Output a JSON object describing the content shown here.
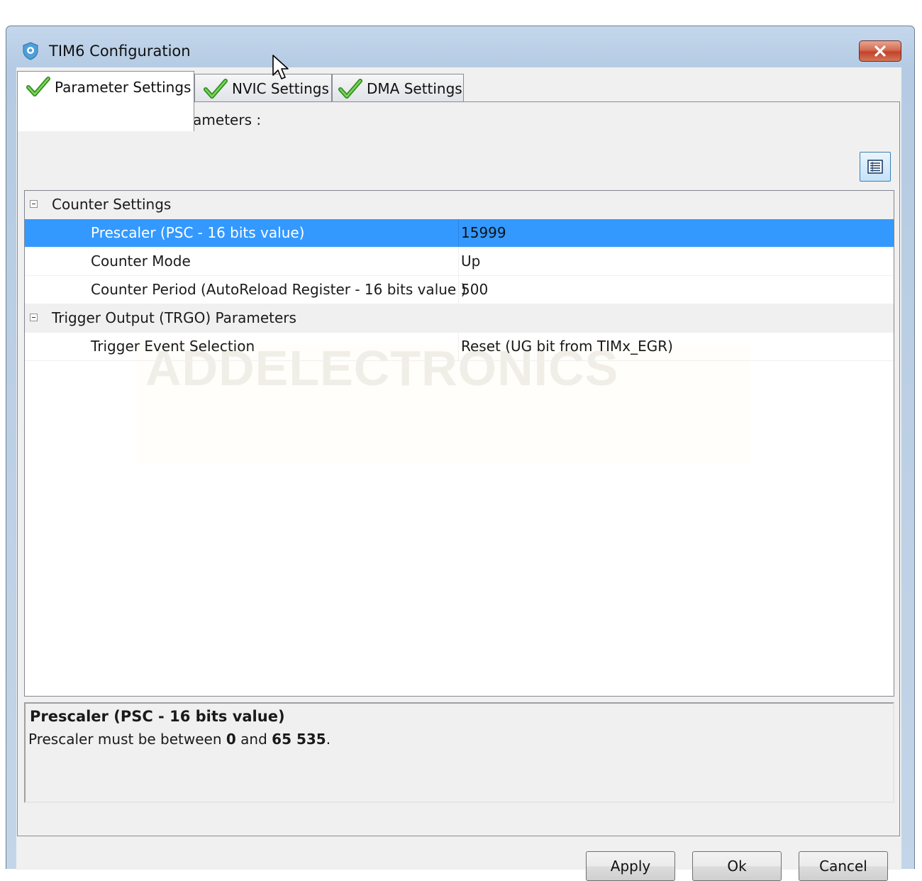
{
  "window": {
    "title": "TIM6 Configuration",
    "close_icon": "close-icon"
  },
  "tabs": [
    {
      "label": "Parameter Settings",
      "active": true,
      "icon": "checkmark-icon"
    },
    {
      "label": "NVIC Settings",
      "active": false,
      "icon": "checkmark-icon"
    },
    {
      "label": "DMA Settings",
      "active": false,
      "icon": "checkmark-icon"
    }
  ],
  "panel": {
    "instructions": "Configure the below parameters :",
    "view_toggle_icon": "list-view-icon"
  },
  "grid": {
    "watermark": "ADDELECTRONICS",
    "categories": [
      {
        "label": "Counter Settings",
        "properties": [
          {
            "name": "Prescaler (PSC - 16 bits value)",
            "value": "15999",
            "selected": true
          },
          {
            "name": "Counter Mode",
            "value": "Up"
          },
          {
            "name": "Counter Period (AutoReload Register - 16 bits value )",
            "value": "500"
          }
        ]
      },
      {
        "label": "Trigger Output (TRGO) Parameters",
        "properties": [
          {
            "name": "Trigger Event Selection",
            "value": "Reset (UG bit from TIMx_EGR)"
          }
        ]
      }
    ]
  },
  "description": {
    "title": "Prescaler (PSC - 16 bits value)",
    "text_prefix": "Prescaler must be between ",
    "min": "0",
    "text_mid": " and ",
    "max": "65 535",
    "text_suffix": "."
  },
  "buttons": {
    "apply": "Apply",
    "ok": "Ok",
    "cancel": "Cancel"
  },
  "colors": {
    "selection": "#3399ff",
    "check_green": "#3fae2a",
    "close_red": "#c24329"
  }
}
